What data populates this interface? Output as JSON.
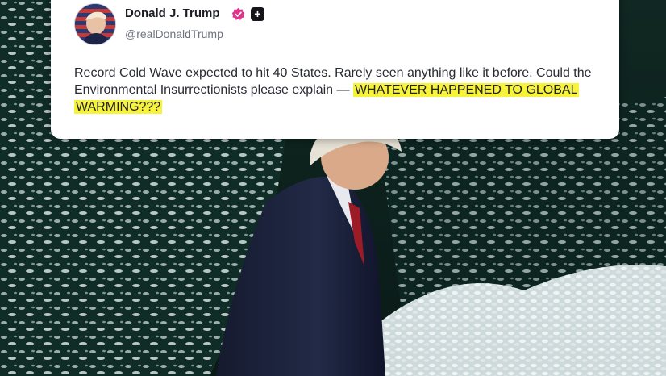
{
  "post": {
    "display_name": "Donald J. Trump",
    "handle": "@realDonaldTrump",
    "verified_icon": "verified-badge-icon",
    "plus_icon": "plus-icon",
    "avatar_icon": "profile-avatar",
    "text_main": "Record Cold Wave expected to hit 40 States. Rarely seen anything like it before. Could the Environmental Insurrectionists please explain —",
    "text_highlight": "WHATEVER HAPPENED TO GLOBAL WARMING???"
  },
  "colors": {
    "highlight": "#f7f33d",
    "verified": "#e0348b",
    "card_bg": "#ffffff",
    "foliage": "#0f2a24",
    "snow": "#dfe9ea"
  }
}
